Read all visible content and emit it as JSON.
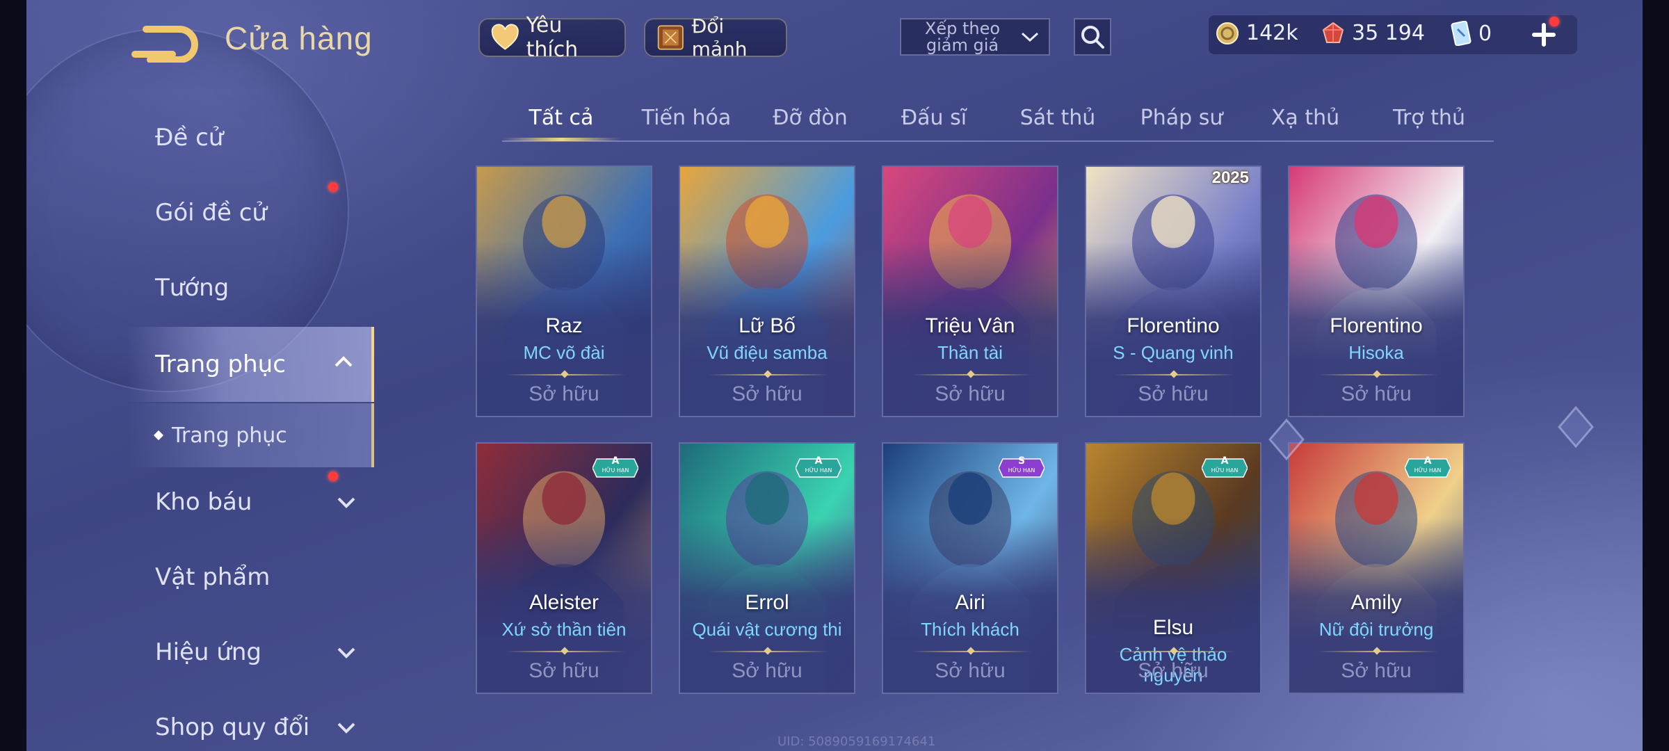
{
  "header": {
    "title": "Cửa hàng",
    "favorite_label": "Yêu thích",
    "trade_label": "Đổi mảnh",
    "sort_label": "Xếp theo giảm giá",
    "currencies": [
      {
        "icon": "gold-coin-icon",
        "value": "142k"
      },
      {
        "icon": "ruby-gem-icon",
        "value": "35 194"
      },
      {
        "icon": "card-ticket-icon",
        "value": "0"
      }
    ]
  },
  "sidebar": {
    "items": [
      {
        "label": "Đề cử"
      },
      {
        "label": "Gói đề cử",
        "notify": true
      },
      {
        "label": "Tướng"
      },
      {
        "label": "Trang phục",
        "expanded": true,
        "active": true
      },
      {
        "label": "Trang phục",
        "sub": true
      },
      {
        "label": "Kho báu",
        "notify": true,
        "expandable": true
      },
      {
        "label": "Vật phẩm"
      },
      {
        "label": "Hiệu ứng",
        "expandable": true
      },
      {
        "label": "Shop quy đổi",
        "expandable": true
      }
    ]
  },
  "tabs": [
    {
      "label": "Tất cả",
      "active": true
    },
    {
      "label": "Tiến hóa"
    },
    {
      "label": "Đỡ đòn"
    },
    {
      "label": "Đấu sĩ"
    },
    {
      "label": "Sát thủ"
    },
    {
      "label": "Pháp sư"
    },
    {
      "label": "Xạ thủ"
    },
    {
      "label": "Trợ thủ"
    }
  ],
  "cards": [
    {
      "hero": "Raz",
      "skin": "MC võ đài",
      "status": "Sở hữu",
      "palette": [
        "#c79a4b",
        "#3d6fb5",
        "#2b3c7a"
      ]
    },
    {
      "hero": "Lữ Bố",
      "skin": "Vũ điệu samba",
      "status": "Sở hữu",
      "palette": [
        "#e8a53b",
        "#4a9be0",
        "#c94f2f"
      ]
    },
    {
      "hero": "Triệu Vân",
      "skin": "Thần tài",
      "status": "Sở hữu",
      "palette": [
        "#d8487c",
        "#7a2f8c",
        "#f0b24a"
      ]
    },
    {
      "hero": "Florentino",
      "skin": "S - Quang vinh",
      "status": "Sở hữu",
      "year_badge": "2025",
      "palette": [
        "#f1e3c4",
        "#7b82c9",
        "#3a3f8f"
      ]
    },
    {
      "hero": "Florentino",
      "skin": "Hisoka",
      "status": "Sở hữu",
      "palette": [
        "#d63a76",
        "#f3f0f5",
        "#2e3f8c"
      ]
    },
    {
      "hero": "Aleister",
      "skin": "Xứ sở thần tiên",
      "status": "Sở hữu",
      "rank": "A",
      "rank_text": "HỮU HẠN",
      "palette": [
        "#8f2c3a",
        "#2c2b5c",
        "#d9a068"
      ]
    },
    {
      "hero": "Errol",
      "skin": "Quái vật cương thi",
      "status": "Sở hữu",
      "rank": "A",
      "rank_text": "HỮU HẠN",
      "palette": [
        "#1e6b7a",
        "#3ad3b0",
        "#5a3f9c"
      ]
    },
    {
      "hero": "Airi",
      "skin": "Thích khách",
      "status": "Sở hữu",
      "rank": "S",
      "rank_text": "HỮU HẠN",
      "palette": [
        "#1c3f7a",
        "#6fb6e8",
        "#3a3f66"
      ]
    },
    {
      "hero": "Elsu",
      "skin": "Cảnh vệ thảo nguyên",
      "status": "Sở hữu",
      "rank": "A",
      "rank_text": "HỮU HẠN",
      "palette": [
        "#b8852f",
        "#5a3a22",
        "#2b4a6e"
      ]
    },
    {
      "hero": "Amily",
      "skin": "Nữ đội trưởng",
      "status": "Sở hữu",
      "rank": "A",
      "rank_text": "HỮU HẠN",
      "palette": [
        "#c73b3b",
        "#f0d08a",
        "#2a4a8a"
      ]
    }
  ],
  "footer": {
    "uid": "UID: 5089059169174641"
  },
  "colors": {
    "accent_gold": "#f0d58a",
    "skin_text": "#7fd6ff",
    "notify_dot": "#ff3b3b"
  }
}
